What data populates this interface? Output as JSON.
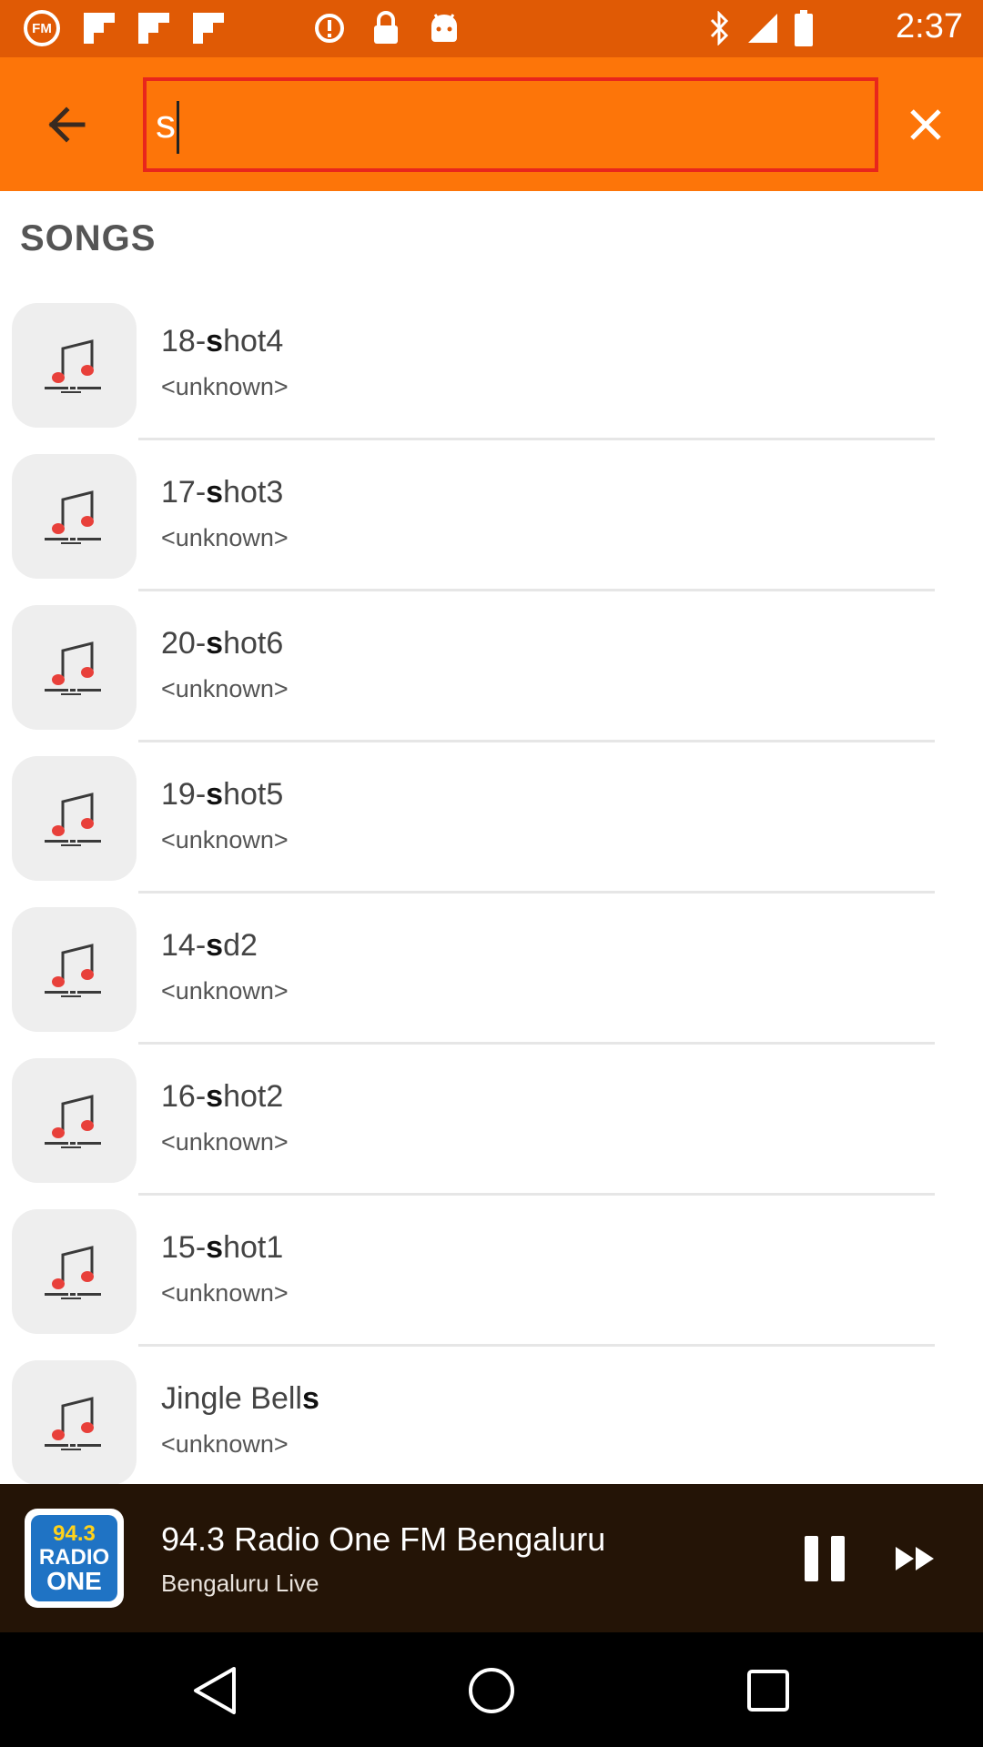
{
  "status_bar": {
    "time": "2:37",
    "icons": [
      "fm-app-icon",
      "flipboard-icon",
      "flipboard-icon",
      "flipboard-icon",
      "info-icon",
      "lock-icon",
      "android-icon",
      "bluetooth-icon",
      "signal-icon",
      "battery-icon"
    ],
    "fm_badge": "FM"
  },
  "toolbar": {
    "search_query": "s",
    "back_icon": "arrow-left-icon",
    "close_icon": "close-icon"
  },
  "section": {
    "title": "SONGS"
  },
  "songs": [
    {
      "prefix": "18-",
      "match": "s",
      "suffix": "hot4",
      "artist": "<unknown>"
    },
    {
      "prefix": "17-",
      "match": "s",
      "suffix": "hot3",
      "artist": "<unknown>"
    },
    {
      "prefix": "20-",
      "match": "s",
      "suffix": "hot6",
      "artist": "<unknown>"
    },
    {
      "prefix": "19-",
      "match": "s",
      "suffix": "hot5",
      "artist": "<unknown>"
    },
    {
      "prefix": "14-",
      "match": "s",
      "suffix": "d2",
      "artist": "<unknown>"
    },
    {
      "prefix": "16-",
      "match": "s",
      "suffix": "hot2",
      "artist": "<unknown>"
    },
    {
      "prefix": "15-",
      "match": "s",
      "suffix": "hot1",
      "artist": "<unknown>"
    },
    {
      "prefix": "Jingle Bell",
      "match": "s",
      "suffix": "",
      "artist": "<unknown>"
    }
  ],
  "player": {
    "station": "94.3 Radio One FM Bengaluru",
    "subtitle": "Bengaluru Live",
    "logo_top": "94.3",
    "logo_mid": "RADIO",
    "logo_bottom": "ONE"
  },
  "colors": {
    "status_bar": "#e05a05",
    "toolbar": "#fd7509",
    "search_border": "#e8261c",
    "player_bg": "#241406",
    "note_dot": "#e8403a"
  }
}
